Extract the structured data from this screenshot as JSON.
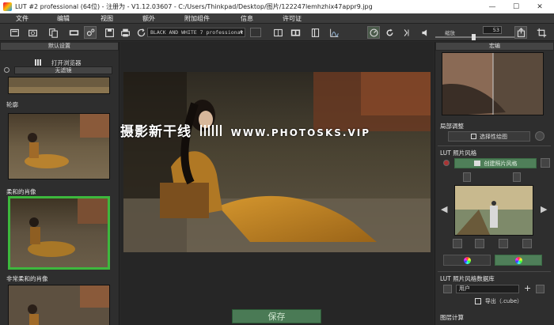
{
  "window": {
    "title": "LUT #2 professional (64位) - 注册为 - V1.12.03607 - C:/Users/Thinkpad/Desktop/图片/122247lemhzhix47appr9.jpg",
    "minimize_glyph": "—",
    "maximize_glyph": "☐",
    "close_glyph": "✕"
  },
  "menu": [
    "文件",
    "编辑",
    "视图",
    "额外",
    "附加组件",
    "信息",
    "许可证"
  ],
  "toolbar": {
    "preset_value": "BLACK AND WHITE 7 professional",
    "preset_arrow": "▼",
    "zoom_label": "缩放",
    "zoom_value": "53"
  },
  "left_panel": {
    "header": "默认设置",
    "open_browser": "打开浏览器",
    "filter_value": "无滤镜",
    "thumbnails": [
      {
        "label": "轮廓",
        "selected": false
      },
      {
        "label": "柔和的肖像",
        "selected": true
      },
      {
        "label": "非常柔和的肖像",
        "selected": false
      }
    ]
  },
  "center": {
    "watermark_cn": "摄影新干线",
    "watermark_url": "WWW.PHOTOSKS.VIP",
    "save_label": "保存"
  },
  "right_panel": {
    "header": "宏编",
    "local_adjust": "局部调整",
    "select_map": "选择性绘图",
    "lut_style_title": "LUT 照片风格",
    "create_style": "创建照片风格",
    "nav_prev": "◀",
    "nav_next": "▶",
    "lut_db_title": "LUT 照片风格数据库",
    "user_value": "用户",
    "export_label": "导出（.cube）",
    "layer_calc": "图层计算"
  },
  "colors": {
    "accent_green": "#3db83d",
    "save_green": "#4a7a55",
    "panel_bg": "#2e2e2e"
  }
}
